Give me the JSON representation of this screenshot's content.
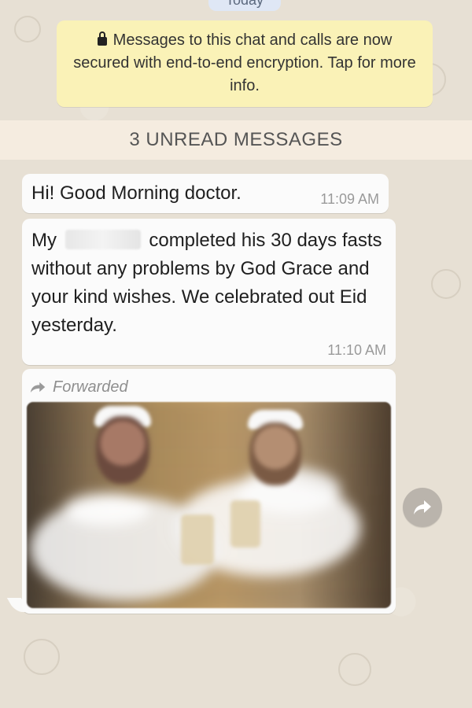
{
  "chat": {
    "date_pill": "Today",
    "encryption_notice": "Messages to this chat and calls are now secured with end-to-end encryption. Tap for more info.",
    "unread_banner": "3 UNREAD MESSAGES"
  },
  "messages": [
    {
      "text": "Hi! Good Morning doctor.",
      "time": "11:09 AM"
    },
    {
      "text_before": "My",
      "text_after": "completed his 30 days fasts without any problems by God Grace and your kind wishes. We celebrated out Eid yesterday.",
      "time": "11:10 AM"
    },
    {
      "forwarded_label": "Forwarded"
    }
  ],
  "icons": {
    "lock": "lock-icon",
    "forward": "forward-icon",
    "share": "share-icon"
  },
  "colors": {
    "chat_background": "#e7e0d4",
    "notice_background": "#faf2b7",
    "bubble_background": "#fbfbfb",
    "unread_background": "#f6ece0"
  }
}
